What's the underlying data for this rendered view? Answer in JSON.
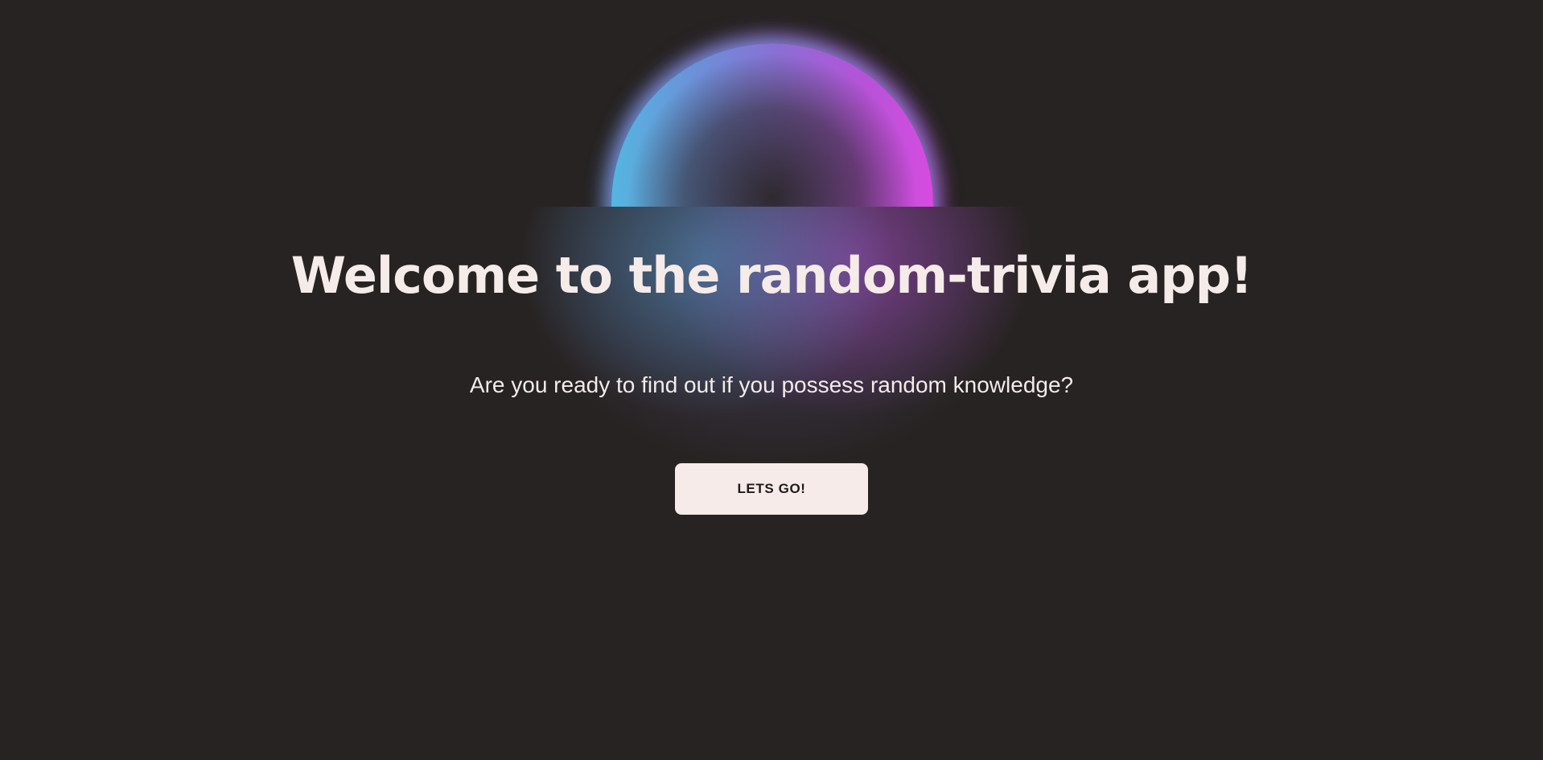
{
  "colors": {
    "background": "#272322",
    "text": "#f5ebe8",
    "button_background": "#f6ebe8",
    "button_text": "#1f1b1a",
    "orb_left": "#54b6e0",
    "orb_right": "#d64ce0"
  },
  "hero": {
    "title": "Welcome to the random-trivia app!",
    "subtitle": "Are you ready to find out if you possess random knowledge?",
    "start_button_label": "LETS GO!"
  }
}
